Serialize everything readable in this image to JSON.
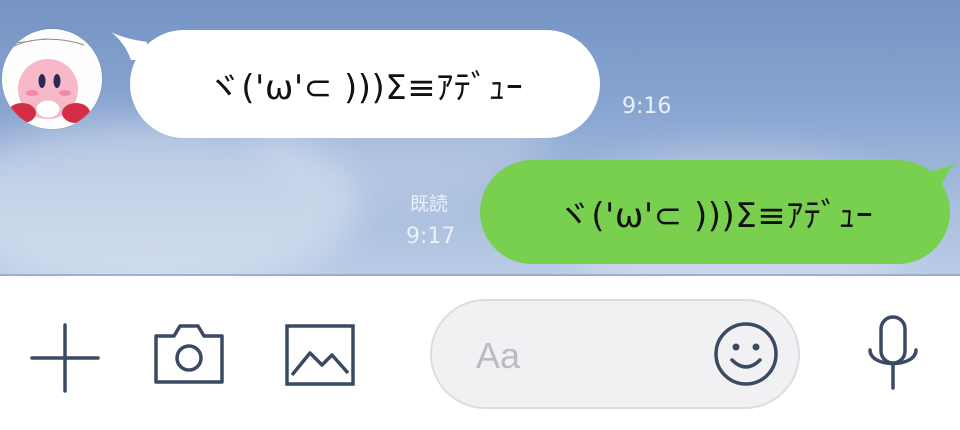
{
  "messages": [
    {
      "direction": "incoming",
      "text": "ヾ('ω'⊂ )))Σ≡ｱﾃﾞｭｰ",
      "time": "9:16"
    },
    {
      "direction": "outgoing",
      "text": "ヾ('ω'⊂ )))Σ≡ｱﾃﾞｭｰ",
      "time": "9:17",
      "read_label": "既読"
    }
  ],
  "input": {
    "placeholder": "Aa",
    "value": ""
  },
  "icons": [
    "plus-icon",
    "camera-icon",
    "image-icon",
    "smiley-icon",
    "microphone-icon"
  ],
  "colors": {
    "outgoing_bubble": "#79d04e",
    "incoming_bubble": "#ffffff",
    "icon_stroke": "#3b4a63"
  }
}
